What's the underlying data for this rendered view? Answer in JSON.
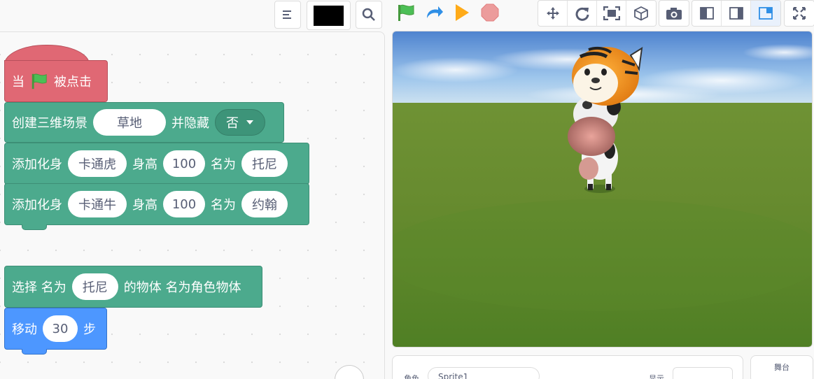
{
  "colors": {
    "event": "#e06874",
    "scene": "#4caa8d",
    "motion": "#4d97ff",
    "flag": "#4cbf56",
    "run": "#ffab19",
    "stop": "#ec9c9c",
    "redo": "#2f8fe6"
  },
  "topbar": {
    "icons": [
      "align-icon",
      "color-swatch",
      "search-icon",
      "green-flag-icon",
      "redo-arrow-icon",
      "play-icon",
      "stop-icon"
    ],
    "tools": [
      "move-icon",
      "rotate-icon",
      "fit-screen-icon",
      "cube-icon",
      "camera-icon",
      "layout-left-icon",
      "layout-right-icon",
      "layout-split-icon",
      "fullscreen-icon"
    ]
  },
  "blocks": {
    "hat": {
      "when": "当",
      "clicked": "被点击"
    },
    "scene": {
      "label": "创建三维场景",
      "scene_value": "草地",
      "hide_label": "并隐藏",
      "hide_value": "否"
    },
    "avatar1": {
      "label": "添加化身",
      "model": "卡通虎",
      "height_label": "身高",
      "height": "100",
      "name_label": "名为",
      "name": "托尼"
    },
    "avatar2": {
      "label": "添加化身",
      "model": "卡通牛",
      "height_label": "身高",
      "height": "100",
      "name_label": "名为",
      "name": "约翰"
    },
    "select": {
      "label": "选择 名为",
      "name": "托尼",
      "suffix": "的物体 名为角色物体"
    },
    "move": {
      "label": "移动",
      "steps": "30",
      "unit": "步"
    }
  },
  "bottom": {
    "sprite_label": "角色",
    "sprite_value": "Sprite1",
    "show_label": "显示",
    "stage_label": "舞台"
  }
}
